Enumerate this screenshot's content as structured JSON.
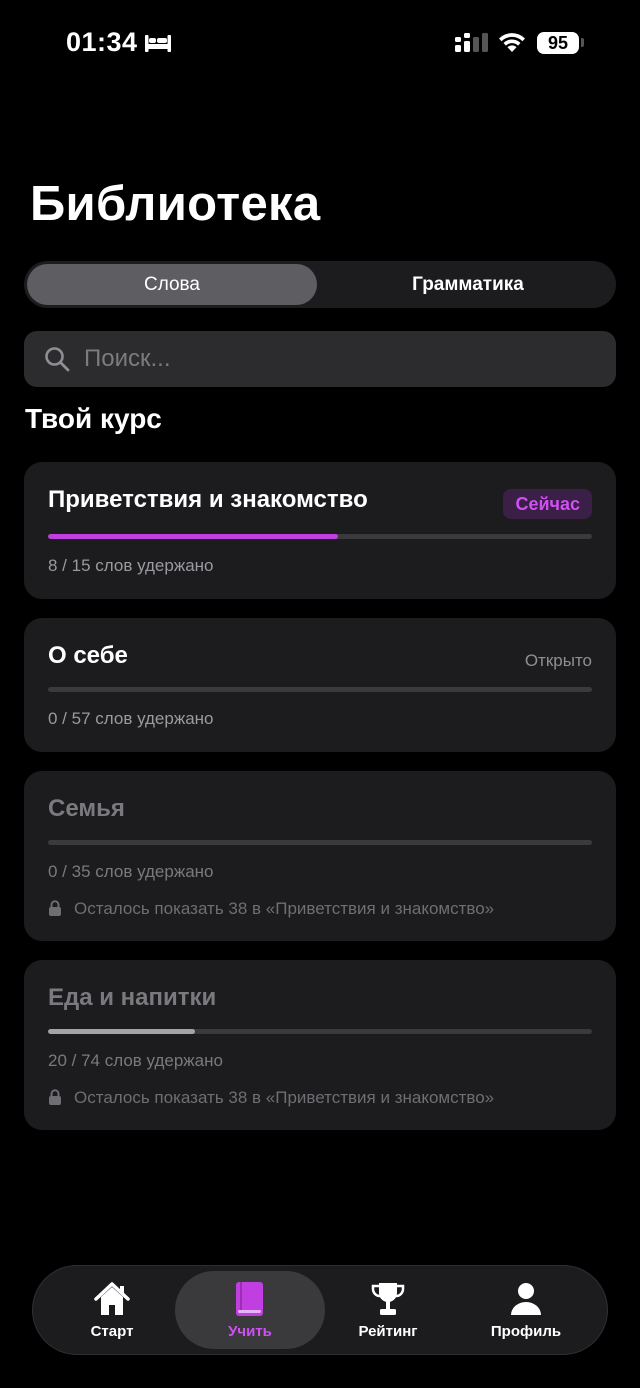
{
  "status_bar": {
    "time": "01:34",
    "battery": "95"
  },
  "page": {
    "title": "Библиотека"
  },
  "segmented": {
    "items": [
      {
        "label": "Слова",
        "active": true
      },
      {
        "label": "Грамматика",
        "active": false
      }
    ]
  },
  "search": {
    "placeholder": "Поиск...",
    "value": ""
  },
  "section": {
    "title": "Твой курс"
  },
  "courses": [
    {
      "title": "Приветствия и знакомство",
      "status": "Сейчас",
      "count": "8 / 15 слов удержано",
      "progress": 0.533,
      "progress_color": "#c13fe0"
    },
    {
      "title": "О себе",
      "status": "Открыто",
      "count": "0 / 57 слов удержано",
      "progress": 0
    },
    {
      "title": "Семья",
      "count": "0 / 35 слов удержано",
      "progress": 0,
      "locked_note": "Осталось показать 38 в «Приветствия и знакомство»"
    },
    {
      "title": "Еда и напитки",
      "count": "20 / 74 слов удержано",
      "progress": 0.27,
      "progress_color": "#a4a4a8",
      "locked_note": "Осталось показать 38 в «Приветствия и знакомство»"
    }
  ],
  "tab_bar": {
    "items": [
      {
        "label": "Старт",
        "icon": "home-icon",
        "active": false
      },
      {
        "label": "Учить",
        "icon": "book-icon",
        "active": true
      },
      {
        "label": "Рейтинг",
        "icon": "trophy-icon",
        "active": false
      },
      {
        "label": "Профиль",
        "icon": "person-icon",
        "active": false
      }
    ]
  },
  "colors": {
    "accent": "#c13fe0",
    "background": "#000000",
    "card": "#1c1c1e"
  }
}
